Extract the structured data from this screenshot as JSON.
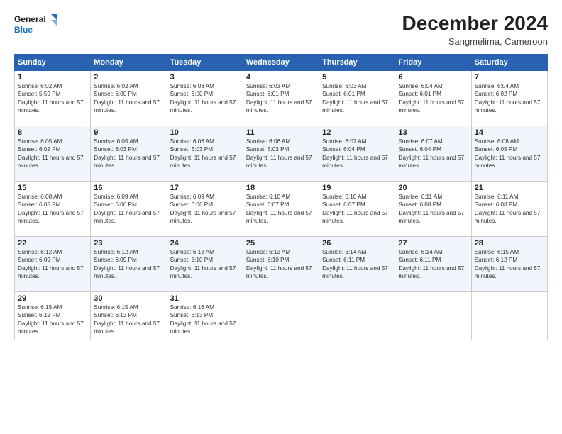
{
  "logo": {
    "line1": "General",
    "line2": "Blue",
    "icon_color": "#1a6fc4"
  },
  "header": {
    "month": "December 2024",
    "location": "Sangmelima, Cameroon"
  },
  "weekdays": [
    "Sunday",
    "Monday",
    "Tuesday",
    "Wednesday",
    "Thursday",
    "Friday",
    "Saturday"
  ],
  "weeks": [
    [
      {
        "day": "1",
        "sunrise": "6:02 AM",
        "sunset": "5:59 PM",
        "daylight": "11 hours and 57 minutes."
      },
      {
        "day": "2",
        "sunrise": "6:02 AM",
        "sunset": "6:00 PM",
        "daylight": "11 hours and 57 minutes."
      },
      {
        "day": "3",
        "sunrise": "6:03 AM",
        "sunset": "6:00 PM",
        "daylight": "11 hours and 57 minutes."
      },
      {
        "day": "4",
        "sunrise": "6:03 AM",
        "sunset": "6:01 PM",
        "daylight": "11 hours and 57 minutes."
      },
      {
        "day": "5",
        "sunrise": "6:03 AM",
        "sunset": "6:01 PM",
        "daylight": "11 hours and 57 minutes."
      },
      {
        "day": "6",
        "sunrise": "6:04 AM",
        "sunset": "6:01 PM",
        "daylight": "11 hours and 57 minutes."
      },
      {
        "day": "7",
        "sunrise": "6:04 AM",
        "sunset": "6:02 PM",
        "daylight": "11 hours and 57 minutes."
      }
    ],
    [
      {
        "day": "8",
        "sunrise": "6:05 AM",
        "sunset": "6:02 PM",
        "daylight": "11 hours and 57 minutes."
      },
      {
        "day": "9",
        "sunrise": "6:05 AM",
        "sunset": "6:03 PM",
        "daylight": "11 hours and 57 minutes."
      },
      {
        "day": "10",
        "sunrise": "6:06 AM",
        "sunset": "6:03 PM",
        "daylight": "11 hours and 57 minutes."
      },
      {
        "day": "11",
        "sunrise": "6:06 AM",
        "sunset": "6:03 PM",
        "daylight": "11 hours and 57 minutes."
      },
      {
        "day": "12",
        "sunrise": "6:07 AM",
        "sunset": "6:04 PM",
        "daylight": "11 hours and 57 minutes."
      },
      {
        "day": "13",
        "sunrise": "6:07 AM",
        "sunset": "6:04 PM",
        "daylight": "11 hours and 57 minutes."
      },
      {
        "day": "14",
        "sunrise": "6:08 AM",
        "sunset": "6:05 PM",
        "daylight": "11 hours and 57 minutes."
      }
    ],
    [
      {
        "day": "15",
        "sunrise": "6:08 AM",
        "sunset": "6:05 PM",
        "daylight": "11 hours and 57 minutes."
      },
      {
        "day": "16",
        "sunrise": "6:09 AM",
        "sunset": "6:06 PM",
        "daylight": "11 hours and 57 minutes."
      },
      {
        "day": "17",
        "sunrise": "6:09 AM",
        "sunset": "6:06 PM",
        "daylight": "11 hours and 57 minutes."
      },
      {
        "day": "18",
        "sunrise": "6:10 AM",
        "sunset": "6:07 PM",
        "daylight": "11 hours and 57 minutes."
      },
      {
        "day": "19",
        "sunrise": "6:10 AM",
        "sunset": "6:07 PM",
        "daylight": "11 hours and 57 minutes."
      },
      {
        "day": "20",
        "sunrise": "6:11 AM",
        "sunset": "6:08 PM",
        "daylight": "11 hours and 57 minutes."
      },
      {
        "day": "21",
        "sunrise": "6:11 AM",
        "sunset": "6:08 PM",
        "daylight": "11 hours and 57 minutes."
      }
    ],
    [
      {
        "day": "22",
        "sunrise": "6:12 AM",
        "sunset": "6:09 PM",
        "daylight": "11 hours and 57 minutes."
      },
      {
        "day": "23",
        "sunrise": "6:12 AM",
        "sunset": "6:09 PM",
        "daylight": "11 hours and 57 minutes."
      },
      {
        "day": "24",
        "sunrise": "6:13 AM",
        "sunset": "6:10 PM",
        "daylight": "11 hours and 57 minutes."
      },
      {
        "day": "25",
        "sunrise": "6:13 AM",
        "sunset": "6:10 PM",
        "daylight": "11 hours and 57 minutes."
      },
      {
        "day": "26",
        "sunrise": "6:14 AM",
        "sunset": "6:11 PM",
        "daylight": "11 hours and 57 minutes."
      },
      {
        "day": "27",
        "sunrise": "6:14 AM",
        "sunset": "6:11 PM",
        "daylight": "11 hours and 57 minutes."
      },
      {
        "day": "28",
        "sunrise": "6:15 AM",
        "sunset": "6:12 PM",
        "daylight": "11 hours and 57 minutes."
      }
    ],
    [
      {
        "day": "29",
        "sunrise": "6:15 AM",
        "sunset": "6:12 PM",
        "daylight": "11 hours and 57 minutes."
      },
      {
        "day": "30",
        "sunrise": "6:15 AM",
        "sunset": "6:13 PM",
        "daylight": "11 hours and 57 minutes."
      },
      {
        "day": "31",
        "sunrise": "6:16 AM",
        "sunset": "6:13 PM",
        "daylight": "11 hours and 57 minutes."
      },
      null,
      null,
      null,
      null
    ]
  ]
}
